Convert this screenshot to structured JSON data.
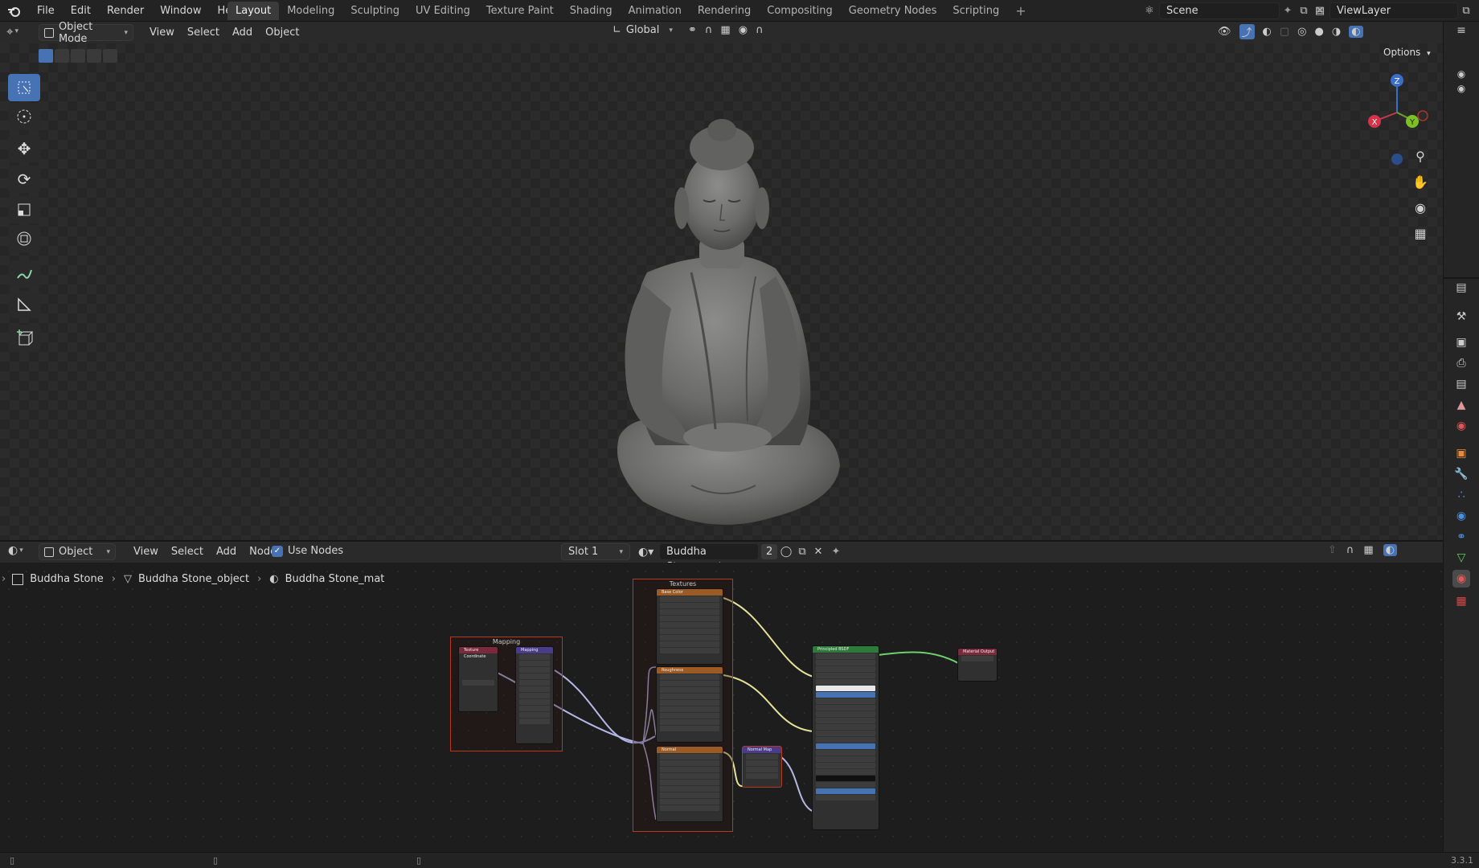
{
  "topbar": {
    "menus": [
      "File",
      "Edit",
      "Render",
      "Window",
      "Help"
    ],
    "workspaces": [
      "Layout",
      "Modeling",
      "Sculpting",
      "UV Editing",
      "Texture Paint",
      "Shading",
      "Animation",
      "Rendering",
      "Compositing",
      "Geometry Nodes",
      "Scripting"
    ],
    "active_workspace": "Layout",
    "add_tab": "+",
    "scene": "Scene",
    "view_layer": "ViewLayer"
  },
  "viewport_header": {
    "mode": "Object Mode",
    "menus": [
      "View",
      "Select",
      "Add",
      "Object"
    ],
    "orientation": "Global",
    "options": "Options"
  },
  "gizmo": {
    "x": "X",
    "y": "Y",
    "z": "Z"
  },
  "node_header": {
    "editor": "Object",
    "menus": [
      "View",
      "Select",
      "Add",
      "Node"
    ],
    "use_nodes": "Use Nodes",
    "slot": "Slot 1",
    "material": "Buddha Stone_mat",
    "users": "2"
  },
  "breadcrumb": {
    "object": "Buddha Stone",
    "mesh": "Buddha Stone_object",
    "material": "Buddha Stone_mat"
  },
  "frames": {
    "mapping": "Mapping",
    "textures": "Textures"
  },
  "nodes": {
    "texcoord": "Texture Coordinate",
    "mapping": "Mapping",
    "basecolor": "Base Color",
    "roughness": "Roughness",
    "normal": "Normal",
    "normalmap": "Normal Map",
    "bsdf": "Principled BSDF",
    "output": "Material Output"
  },
  "status": {
    "version": "3.3.1"
  },
  "colors": {
    "accent": "#4772b3",
    "frame_border": "#b5391e"
  }
}
